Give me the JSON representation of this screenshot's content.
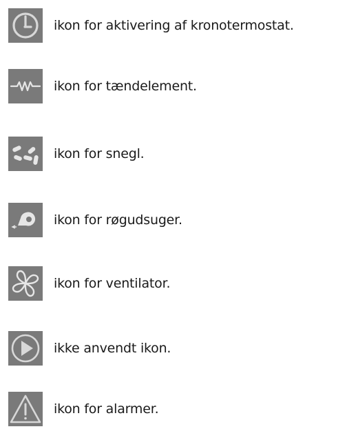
{
  "legend": {
    "items": [
      {
        "icon": "clock-power-icon",
        "label": "ikon for aktivering af kronotermostat."
      },
      {
        "icon": "heating-element-icon",
        "label": "ikon for tændelement."
      },
      {
        "icon": "pellet-auger-icon",
        "label": "ikon for snegl."
      },
      {
        "icon": "smoke-extractor-icon",
        "label": "ikon for røgudsuger."
      },
      {
        "icon": "fan-icon",
        "label": "ikon for ventilator."
      },
      {
        "icon": "play-icon",
        "label": "ikke anvendt ikon."
      },
      {
        "icon": "alarm-warning-icon",
        "label": "ikon for alarmer."
      }
    ]
  },
  "colors": {
    "tile_background": "#7a7a7a",
    "icon_stroke": "#d8d8d8",
    "text": "#1a1a1a"
  }
}
